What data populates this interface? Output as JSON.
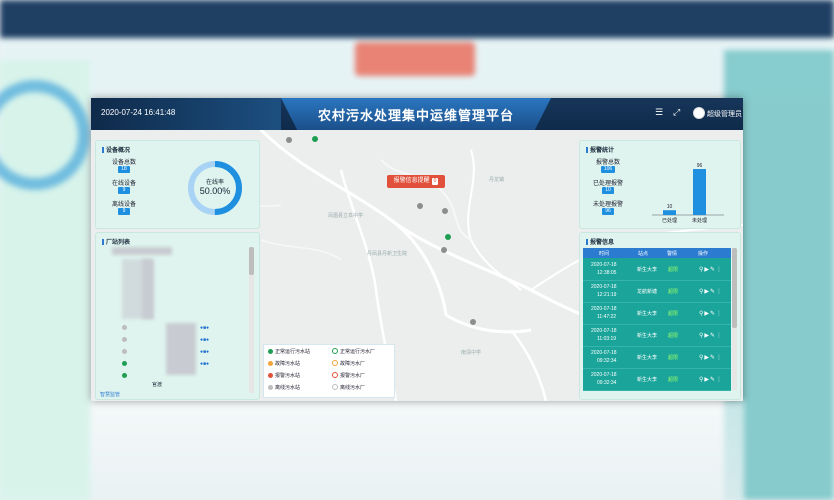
{
  "header": {
    "datetime": "2020-07-24 16:41:48",
    "title": "农村污水处理集中运维管理平台",
    "menu_icon": "menu-icon",
    "fullscreen_icon": "fullscreen-icon",
    "user": "超级管理员"
  },
  "map": {
    "alarm_button": "报警信息提醒",
    "alarm_count": "0",
    "labels": [
      "丹龙镇",
      "凤凰县立阜中学",
      "丹凤县丹新卫生院",
      "南清中学"
    ]
  },
  "device_panel": {
    "title": "设备概况",
    "total_label": "设备总数",
    "total": "18",
    "online_label": "在线设备",
    "online": "9",
    "offline_label": "离线设备",
    "offline": "9",
    "rate_label": "在线率",
    "rate_value": "50.00%",
    "rate_fraction": 0.5
  },
  "station_panel": {
    "title": "厂站列表",
    "visible_item": "官渡",
    "footer": "智慧监管"
  },
  "legend": {
    "items": [
      {
        "label": "正常运行污水站",
        "color": "#1e9e52",
        "style": "dot"
      },
      {
        "label": "正常运行污水厂",
        "color": "#1e9e52",
        "style": "ring"
      },
      {
        "label": "故障污水站",
        "color": "#f2a33a",
        "style": "dot"
      },
      {
        "label": "故障污水厂",
        "color": "#f2a33a",
        "style": "ring"
      },
      {
        "label": "报警污水站",
        "color": "#e0503a",
        "style": "dot"
      },
      {
        "label": "报警污水厂",
        "color": "#e0503a",
        "style": "ring"
      },
      {
        "label": "离线污水站",
        "color": "#bdbdbd",
        "style": "dot"
      },
      {
        "label": "离线污水厂",
        "color": "#bdbdbd",
        "style": "ring"
      }
    ]
  },
  "alarm_stats": {
    "title": "报警统计",
    "total_label": "报警总数",
    "total": "106",
    "handled_label": "已处理报警",
    "handled": "10",
    "unhandled_label": "未处理报警",
    "unhandled": "96"
  },
  "chart_data": {
    "type": "bar",
    "categories": [
      "已处理",
      "未处理"
    ],
    "values": [
      10,
      96
    ],
    "ylim": [
      0,
      96
    ]
  },
  "alarm_info": {
    "title": "报警信息",
    "columns": [
      "时间",
      "站点",
      "警情",
      "操作"
    ],
    "rows": [
      {
        "date": "2020-07-18",
        "time": "12:38:05",
        "site": "新生大李",
        "status": "超限"
      },
      {
        "date": "2020-07-18",
        "time": "12:21:19",
        "site": "龙航新塘",
        "status": "超限"
      },
      {
        "date": "2020-07-18",
        "time": "11:47:22",
        "site": "新生大李",
        "status": "超限"
      },
      {
        "date": "2020-07-18",
        "time": "11:03:19",
        "site": "新生大李",
        "status": "超限"
      },
      {
        "date": "2020-07-18",
        "time": "09:32:34",
        "site": "新生大李",
        "status": "超限"
      },
      {
        "date": "2020-07-18",
        "time": "09:32:34",
        "site": "新生大李",
        "status": "超限"
      }
    ]
  }
}
